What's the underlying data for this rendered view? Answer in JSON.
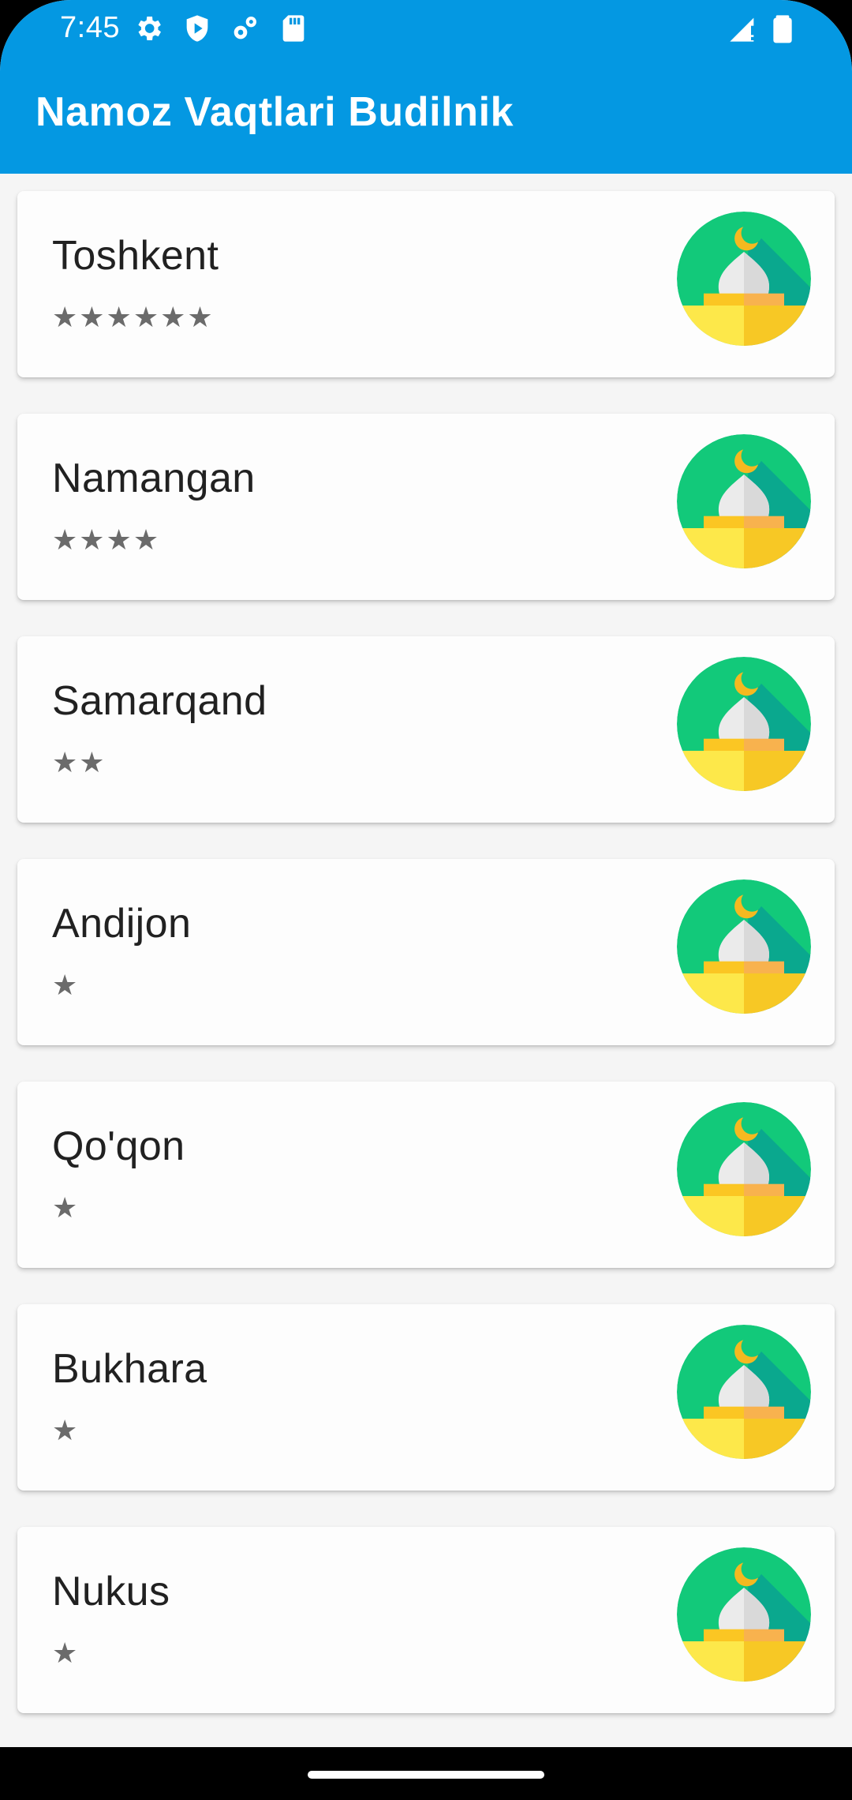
{
  "status_bar": {
    "time": "7:45",
    "icons_left": [
      "settings-icon",
      "play-protect-icon",
      "settings-gear-icon",
      "sd-card-icon"
    ],
    "icons_right": [
      "signal-icon",
      "battery-icon"
    ]
  },
  "app_bar": {
    "title": "Namoz Vaqtlari Budilnik",
    "color": "#0498e2"
  },
  "cities": [
    {
      "name": "Toshkent",
      "stars": "★★★★★★",
      "rating": 6,
      "icon": "mosque-icon"
    },
    {
      "name": "Namangan",
      "stars": "★★★★",
      "rating": 4,
      "icon": "mosque-icon"
    },
    {
      "name": "Samarqand",
      "stars": "★★",
      "rating": 2,
      "icon": "mosque-icon"
    },
    {
      "name": "Andijon",
      "stars": "★",
      "rating": 1,
      "icon": "mosque-icon"
    },
    {
      "name": "Qo'qon",
      "stars": "★",
      "rating": 1,
      "icon": "mosque-icon"
    },
    {
      "name": "Bukhara",
      "stars": "★",
      "rating": 1,
      "icon": "mosque-icon"
    },
    {
      "name": "Nukus",
      "stars": "★",
      "rating": 1,
      "icon": "mosque-icon"
    }
  ],
  "colors": {
    "mosque_circle": "#12c97a",
    "mosque_shadow": "#0aa88e",
    "mosque_base_light": "#fde84a",
    "mosque_base_dark": "#f7c825",
    "moon": "#f5b920"
  }
}
